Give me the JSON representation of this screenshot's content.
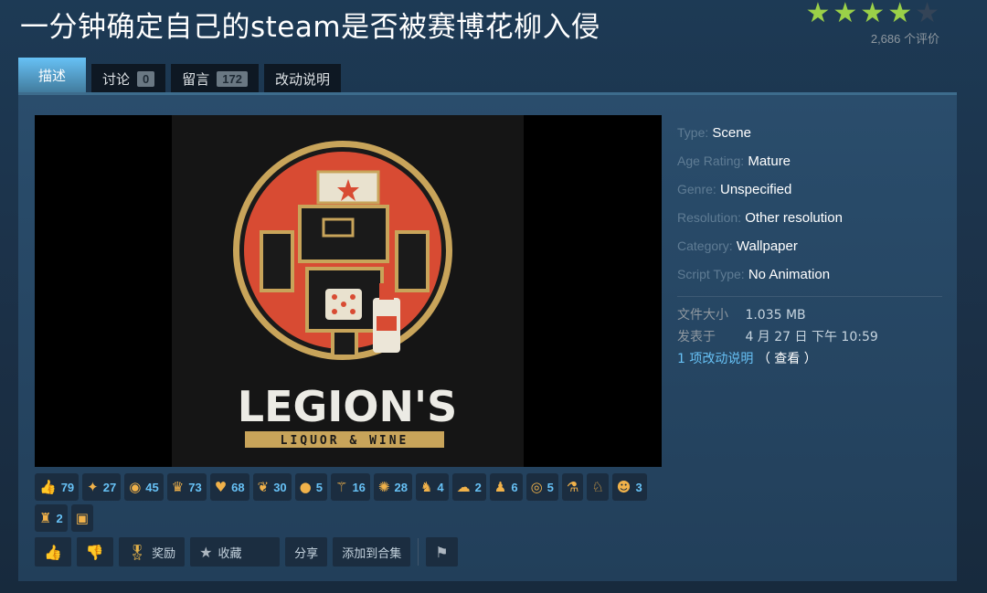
{
  "title": "一分钟确定自己的steam是否被赛博花柳入侵",
  "rating": {
    "stars_filled": 4,
    "stars_total": 5,
    "count_text": "2,686 个评价"
  },
  "tabs": [
    {
      "label": "描述",
      "active": true
    },
    {
      "label": "讨论",
      "badge": "0"
    },
    {
      "label": "留言",
      "badge": "172"
    },
    {
      "label": "改动说明"
    }
  ],
  "preview": {
    "logo_line1": "LEGION'S",
    "logo_line2": "LIQUOR & WINE"
  },
  "info": {
    "type": {
      "label": "Type:",
      "value": "Scene"
    },
    "age": {
      "label": "Age Rating:",
      "value": "Mature"
    },
    "genre": {
      "label": "Genre:",
      "value": "Unspecified"
    },
    "resolution": {
      "label": "Resolution:",
      "value": "Other resolution"
    },
    "category": {
      "label": "Category:",
      "value": "Wallpaper"
    },
    "script": {
      "label": "Script Type:",
      "value": "No Animation"
    }
  },
  "meta": {
    "size_label": "文件大小",
    "size_value": "1.035 MB",
    "posted_label": "发表于",
    "posted_value": "4 月 27 日 下午 10:59",
    "changes_text": "1 项改动说明",
    "view_text": "（ 查看 ）"
  },
  "awards": [
    {
      "icon": "thumbs-icon",
      "glyph": "👍",
      "count": "79"
    },
    {
      "icon": "wings-icon",
      "glyph": "✦",
      "count": "27"
    },
    {
      "icon": "fish-icon",
      "glyph": "◉",
      "count": "45"
    },
    {
      "icon": "crown-icon",
      "glyph": "♛",
      "count": "73"
    },
    {
      "icon": "heart-icon",
      "glyph": "♥",
      "count": "68"
    },
    {
      "icon": "lips-icon",
      "glyph": "❦",
      "count": "30"
    },
    {
      "icon": "cookie-icon",
      "glyph": "●",
      "count": "5"
    },
    {
      "icon": "wand-icon",
      "glyph": "⚚",
      "count": "16"
    },
    {
      "icon": "sun-icon",
      "glyph": "✺",
      "count": "28"
    },
    {
      "icon": "cat-icon",
      "glyph": "♞",
      "count": "4"
    },
    {
      "icon": "brain-icon",
      "glyph": "☁",
      "count": "2"
    },
    {
      "icon": "bust-icon",
      "glyph": "♟",
      "count": "6"
    },
    {
      "icon": "eye-icon",
      "glyph": "◎",
      "count": "5"
    },
    {
      "icon": "potion-icon",
      "glyph": "⚗",
      "count": ""
    },
    {
      "icon": "fox-icon",
      "glyph": "♘",
      "count": ""
    },
    {
      "icon": "helmet-icon",
      "glyph": "☻",
      "count": "3"
    },
    {
      "icon": "rooster-icon",
      "glyph": "♜",
      "count": "2"
    },
    {
      "icon": "gift-icon",
      "glyph": "▣",
      "count": ""
    }
  ],
  "actions": {
    "award_label": "奖励",
    "favorite_label": "收藏",
    "share_label": "分享",
    "collection_label": "添加到合集"
  },
  "colors": {
    "accent": "#67c1f5",
    "star": "#9bd148",
    "panel": "#2a4d6c"
  }
}
